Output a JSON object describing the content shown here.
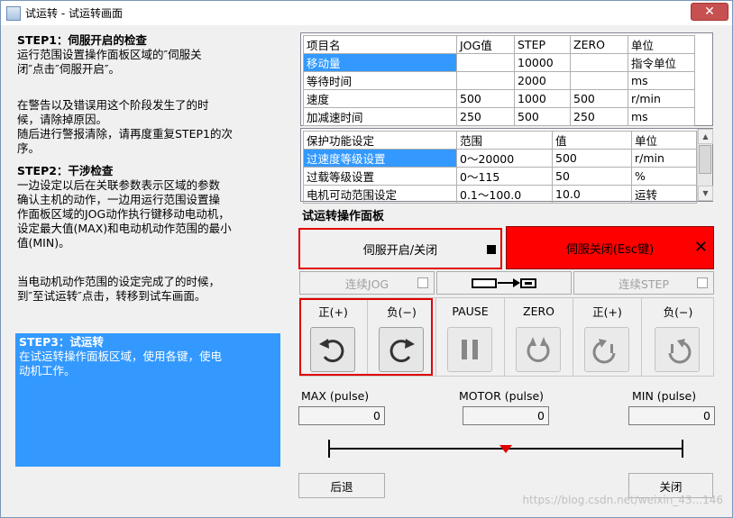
{
  "window": {
    "title": "试运转 - 试运转画面",
    "close_label": "✕"
  },
  "left": {
    "step1_title": "STEP1：伺服开启的检查",
    "step1_lines": [
      "运行范围设置操作面板区域的″伺服关",
      "闭″点击″伺服开启″。"
    ],
    "step1_warn_lines": [
      "在警告以及错误用这个阶段发生了的时",
      "候，请除掉原因。",
      "随后进行警报清除，请再度重复STEP1的次",
      "序。"
    ],
    "step2_title": "STEP2：干涉检查",
    "step2_lines": [
      "一边设定以后在关联参数表示区域的参数",
      "确认主机的动作，一边用运行范围设置操",
      "作面板区域的JOG动作执行键移动电动机，",
      "设定最大值(MAX)和电动机动作范围的最小",
      "值(MIN)。"
    ],
    "step2_end_lines": [
      "当电动机动作范围的设定完成了的时候，",
      "到″至试运转″点击，转移到试车画面。"
    ],
    "step3_title": "STEP3：试运转",
    "step3_lines": [
      "在试运转操作面板区域，使用各键，使电",
      "动机工作。"
    ]
  },
  "table1": {
    "headers": [
      "项目名",
      "JOG值",
      "STEP",
      "ZERO",
      "单位"
    ],
    "rows": [
      [
        "移动量",
        "",
        "10000",
        "",
        "指令单位"
      ],
      [
        "等待时间",
        "",
        "2000",
        "",
        "ms"
      ],
      [
        "速度",
        "500",
        "1000",
        "500",
        "r/min"
      ],
      [
        "加减速时间",
        "250",
        "500",
        "250",
        "ms"
      ]
    ]
  },
  "table2": {
    "headers": [
      "保护功能设定",
      "范围",
      "值",
      "单位"
    ],
    "rows": [
      [
        "过速度等级设置",
        "0～20000",
        "500",
        "r/min"
      ],
      [
        "过载等级设置",
        "0～115",
        "50",
        "%"
      ],
      [
        "电机可动范围设定",
        "0.1～100.0",
        "10.0",
        "运转"
      ]
    ]
  },
  "panel": {
    "title": "试运转操作面板",
    "servo_toggle": "伺服开启/关闭",
    "servo_status": "伺服关闭(Esc键)",
    "servo_status_x": "✕",
    "jog_continuous": "连续JOG",
    "step_continuous": "连续STEP",
    "label_pos": "正(+)",
    "label_neg": "负(−)",
    "label_pause": "PAUSE",
    "label_zero": "ZERO",
    "label_pos2": "正(+)",
    "label_neg2": "负(−)"
  },
  "readouts": {
    "max_label": "MAX (pulse)",
    "motor_label": "MOTOR (pulse)",
    "min_label": "MIN (pulse)",
    "max_value": "0",
    "motor_value": "0",
    "min_value": "0"
  },
  "footer": {
    "back": "后退",
    "close": "关闭"
  },
  "watermark": "https://blog.csdn.net/weixin_43...146"
}
